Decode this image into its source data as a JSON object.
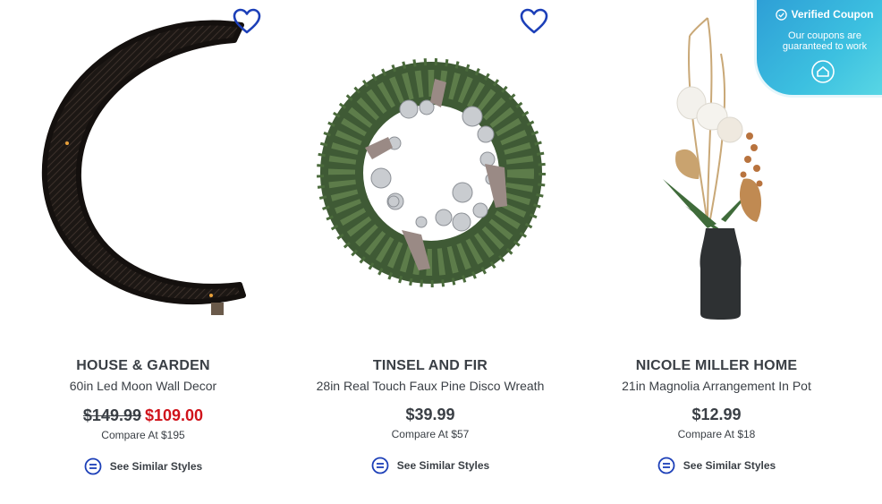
{
  "products": [
    {
      "brand": "HOUSE & GARDEN",
      "title": "60in Led Moon Wall Decor",
      "original_price": "$149.99",
      "sale_price": "$109.00",
      "compare_label": "Compare At  $195",
      "similar_label": "See Similar Styles",
      "image_icon": "moon-wall-decor-image",
      "favorite_icon": "heart-icon"
    },
    {
      "brand": "TINSEL AND FIR",
      "title": "28in Real Touch Faux Pine Disco Wreath",
      "price": "$39.99",
      "compare_label": "Compare At  $57",
      "similar_label": "See Similar Styles",
      "image_icon": "disco-wreath-image",
      "favorite_icon": "heart-icon"
    },
    {
      "brand": "NICOLE MILLER HOME",
      "title": "21in Magnolia Arrangement In Pot",
      "price": "$12.99",
      "compare_label": "Compare At  $18",
      "similar_label": "See Similar Styles",
      "image_icon": "magnolia-arrangement-image",
      "favorite_icon": "heart-icon"
    }
  ],
  "coupon": {
    "title": "Verified Coupon",
    "subtitle": "Our coupons are guaranteed to work",
    "icon": "home-icon"
  },
  "colors": {
    "heart": "#1c3fb8",
    "sale_price": "#d0131b",
    "text": "#3a3f45",
    "coupon_bg": "#3cb4e0"
  }
}
